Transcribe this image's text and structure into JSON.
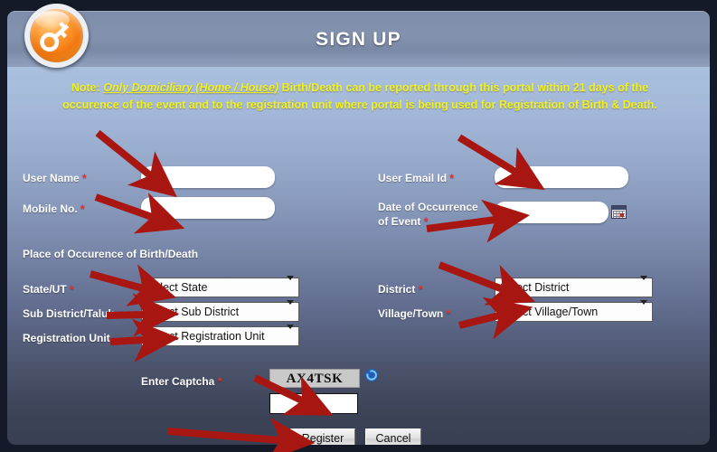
{
  "header": {
    "title": "SIGN UP",
    "logo_icon": "key-icon"
  },
  "note": {
    "prefix": "Note: ",
    "emphasis": "Only Domiciliary (Home / House)",
    "rest": " Birth/Death can be reported through this portal within 21 days of the occurence of the event and to the registration unit where portal is being used for Registration of Birth & Death.",
    "color": "#f2f21a"
  },
  "form": {
    "user_name": {
      "label": "User Name",
      "required": "*",
      "value": "",
      "placeholder": ""
    },
    "user_email": {
      "label": "User Email Id",
      "required": "*",
      "value": "",
      "placeholder": ""
    },
    "mobile_no": {
      "label": "Mobile No.",
      "required": "*",
      "value": "",
      "placeholder": ""
    },
    "date_of_occurrence": {
      "label_line1": "Date of Occurrence",
      "label_line2": "of Event",
      "required": "*",
      "value": "",
      "placeholder": "",
      "calendar_icon": "calendar-icon"
    },
    "section_title": "Place of Occurence of Birth/Death",
    "state": {
      "label": "State/UT",
      "required": "*",
      "selected": "Select State",
      "options": [
        "Select State"
      ]
    },
    "district": {
      "label": "District",
      "required": "*",
      "selected": "Select District",
      "options": [
        "Select District"
      ]
    },
    "sub_district": {
      "label": "Sub District/Taluk",
      "required": "",
      "selected": "Select Sub District",
      "options": [
        "Select Sub District"
      ]
    },
    "village_town": {
      "label": "Village/Town",
      "required": "*",
      "selected": "Select Village/Town",
      "options": [
        "Select Village/Town"
      ]
    },
    "registration_unit": {
      "label": "Registration Unit",
      "required": "",
      "selected": "Select Registration Unit",
      "options": [
        "Select Registration Unit"
      ]
    }
  },
  "captcha": {
    "label": "Enter Captcha",
    "required": "*",
    "code": "AX4TSK",
    "input_value": "",
    "refresh_icon": "refresh-icon"
  },
  "buttons": {
    "register": "Register",
    "cancel": "Cancel"
  },
  "annotations": {
    "arrow_color": "#a81612",
    "count": 10
  },
  "colors": {
    "page_bg": "#151a28",
    "header_bar": "#8392ae",
    "panel_top": "#a9c0de",
    "panel_bottom": "#393f52",
    "note_yellow": "#f2f21a",
    "required_red": "#e8332a",
    "arrow_red": "#a81612"
  }
}
